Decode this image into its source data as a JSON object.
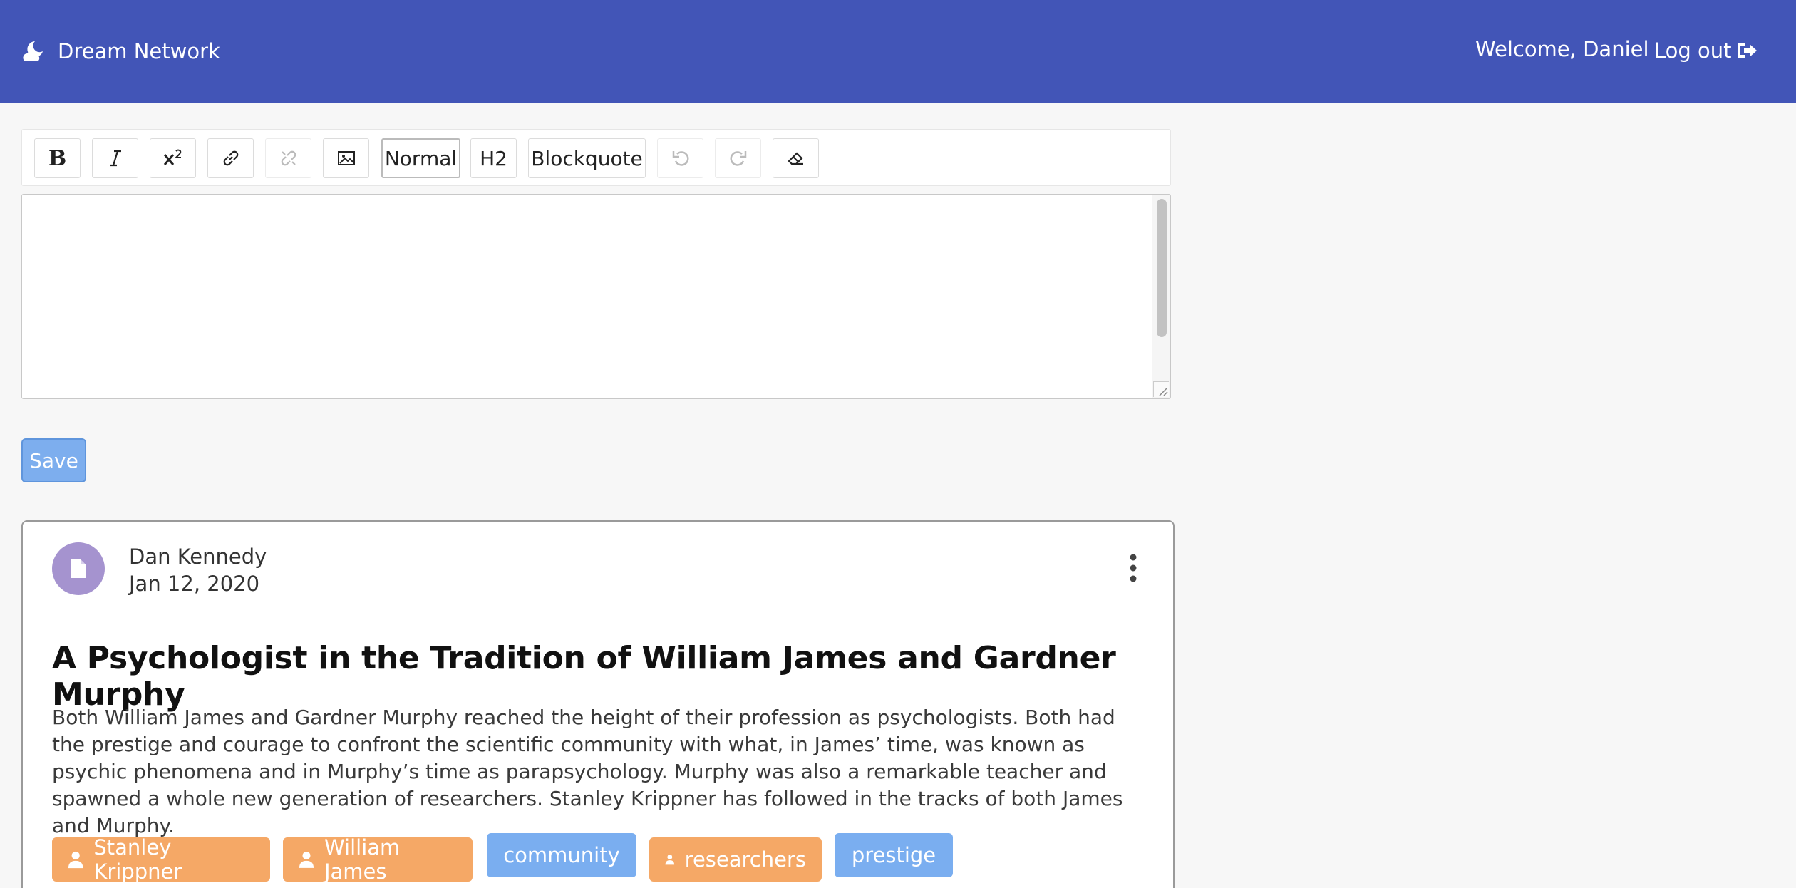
{
  "header": {
    "brand_name": "Dream Network",
    "brand_icon": "moon-cloud-icon",
    "welcome_text": "Welcome, Daniel",
    "logout_label": "Log out",
    "background_color": "#4255b7"
  },
  "toolbar": {
    "bold_label": "B",
    "normal_label": "Normal",
    "h2_label": "H2",
    "blockquote_label": "Blockquote",
    "icons": [
      "bold-icon",
      "italic-icon",
      "superscript-icon",
      "link-icon",
      "unlink-icon",
      "image-icon",
      "undo-icon",
      "redo-icon",
      "eraser-icon"
    ]
  },
  "editor": {
    "content": ""
  },
  "save_label": "Save",
  "post": {
    "author": "Dan Kennedy",
    "date": "Jan 12, 2020",
    "title": "A Psychologist in the Tradition of William James and Gardner Murphy",
    "body": "Both William James and Gardner Murphy reached the height of their profession as psychologists. Both had the prestige and courage to confront the scientific community with what, in James’ time, was known as psychic phenomena and in Murphy’s time as parapsychology. Murphy was also a remarkable teacher and spawned a whole new generation of researchers. Stanley Krippner has followed in the tracks of both James and Murphy.",
    "tags": [
      {
        "label": "Stanley Krippner",
        "kind": "person"
      },
      {
        "label": "William James",
        "kind": "person"
      },
      {
        "label": "community",
        "kind": "topic"
      },
      {
        "label": "researchers",
        "kind": "person"
      },
      {
        "label": "prestige",
        "kind": "topic"
      }
    ],
    "tag_colors": {
      "person": "#f5a866",
      "topic": "#7aaef0"
    }
  }
}
